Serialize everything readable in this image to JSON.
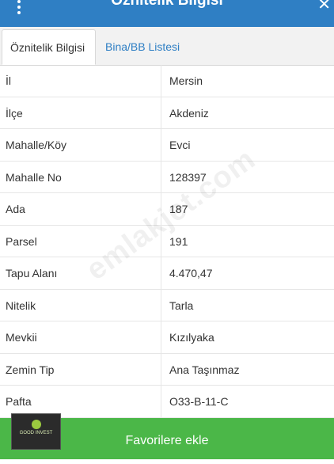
{
  "header": {
    "title": "Öznitelik Bilgisi",
    "menu_icon": "kebab-menu-icon",
    "close_icon": "close-icon",
    "close_glyph": "✕"
  },
  "tabs": [
    {
      "label": "Öznitelik Bilgisi",
      "active": true
    },
    {
      "label": "Bina/BB Listesi",
      "active": false
    }
  ],
  "attributes": [
    {
      "label": "İl",
      "value": "Mersin"
    },
    {
      "label": "İlçe",
      "value": "Akdeniz"
    },
    {
      "label": "Mahalle/Köy",
      "value": "Evci"
    },
    {
      "label": "Mahalle No",
      "value": "128397"
    },
    {
      "label": "Ada",
      "value": "187"
    },
    {
      "label": "Parsel",
      "value": "191"
    },
    {
      "label": "Tapu Alanı",
      "value": "4.470,47"
    },
    {
      "label": "Nitelik",
      "value": "Tarla"
    },
    {
      "label": "Mevkii",
      "value": "Kızılyaka"
    },
    {
      "label": "Zemin Tip",
      "value": "Ana Taşınmaz"
    },
    {
      "label": "Pafta",
      "value": "O33-B-11-C"
    }
  ],
  "watermark": "emlakjet.com",
  "logo": {
    "text": "GOOD INVEST"
  },
  "favorite_button": {
    "label": "Favorilere ekle"
  },
  "colors": {
    "header": "#2f7fc4",
    "accent": "#2f7fc4",
    "favorite": "#4bb748"
  }
}
